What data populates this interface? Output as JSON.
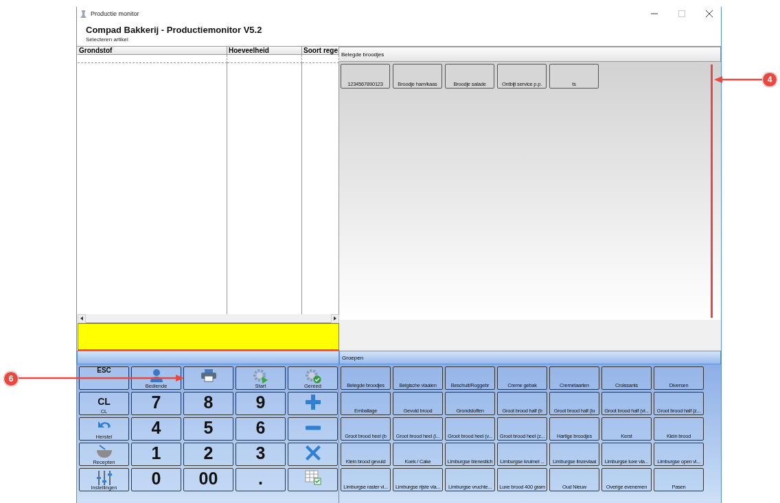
{
  "window": {
    "title": "Productie monitor",
    "controls": [
      {
        "kind": "minimize",
        "disabled": false
      },
      {
        "kind": "maximize",
        "disabled": true
      },
      {
        "kind": "close",
        "disabled": false
      }
    ]
  },
  "header": {
    "title": "Compad Bakkerij - Productiemonitor V5.2",
    "subtitle": "Selecteren artikel"
  },
  "table": {
    "columns": [
      "Grondstof",
      "Hoeveelheid",
      "Soort rege"
    ]
  },
  "articles": {
    "title": "Belegde broodjes",
    "items": [
      "1234567890123",
      "Broodje ham/kaas",
      "Broodje salade",
      "Ontbijt service p.p.",
      "ts"
    ]
  },
  "groups": {
    "title": "Groepen",
    "items": [
      "Belegde broodjes",
      "Belgische vlaaien",
      "Beschuit/Roggebr",
      "Creme gebak",
      "Cremetaarten",
      "Croissants",
      "Diversen",
      "Emballage",
      "Gevuld brood",
      "Grondstoffen",
      "Groot brood half (b",
      "Groot brood half (lu",
      "Groot brood half (vl...",
      "Groot brood half (z...",
      "Groot brood heel (b",
      "Groot brood heel (l...",
      "Groot brood heel (v...",
      "Groot brood heel (z...",
      "Hartige broodjes",
      "Kerst",
      "Klein brood",
      "Klein brood gevuld",
      "Koek / Cake",
      "Limburgse bienestich",
      "Limburgse kruimel ...",
      "Limburgse linzevlaai",
      "Limburgse luxe vla...",
      "Limburgse open vl...",
      "Limburgse raster vl...",
      "Limburgse rijste vla...",
      "Limburgse vruchte...",
      "Luxe brood 400 gram",
      "Oud  Nieuw",
      "Overige evenemen",
      "Pasen"
    ]
  },
  "keypad": [
    {
      "kind": "text",
      "big": "ESC"
    },
    {
      "kind": "user",
      "label": "Bediende"
    },
    {
      "kind": "printer"
    },
    {
      "kind": "start",
      "label": "Start"
    },
    {
      "kind": "done",
      "label": "Gereed"
    },
    {
      "kind": "text",
      "big": "CL",
      "label": "CL"
    },
    {
      "kind": "digit",
      "big": "7"
    },
    {
      "kind": "digit",
      "big": "8"
    },
    {
      "kind": "digit",
      "big": "9"
    },
    {
      "kind": "plus"
    },
    {
      "kind": "undo",
      "label": "Herstel"
    },
    {
      "kind": "digit",
      "big": "4"
    },
    {
      "kind": "digit",
      "big": "5"
    },
    {
      "kind": "digit",
      "big": "6"
    },
    {
      "kind": "minus"
    },
    {
      "kind": "mortar",
      "label": "Recepten"
    },
    {
      "kind": "digit",
      "big": "1"
    },
    {
      "kind": "digit",
      "big": "2"
    },
    {
      "kind": "digit",
      "big": "3"
    },
    {
      "kind": "times"
    },
    {
      "kind": "sliders",
      "label": "Instellingen"
    },
    {
      "kind": "digit",
      "big": "0"
    },
    {
      "kind": "digit",
      "big": "00"
    },
    {
      "kind": "digit",
      "big": "."
    },
    {
      "kind": "grid"
    }
  ],
  "annotations": [
    {
      "label": "4"
    },
    {
      "label": "6"
    }
  ]
}
